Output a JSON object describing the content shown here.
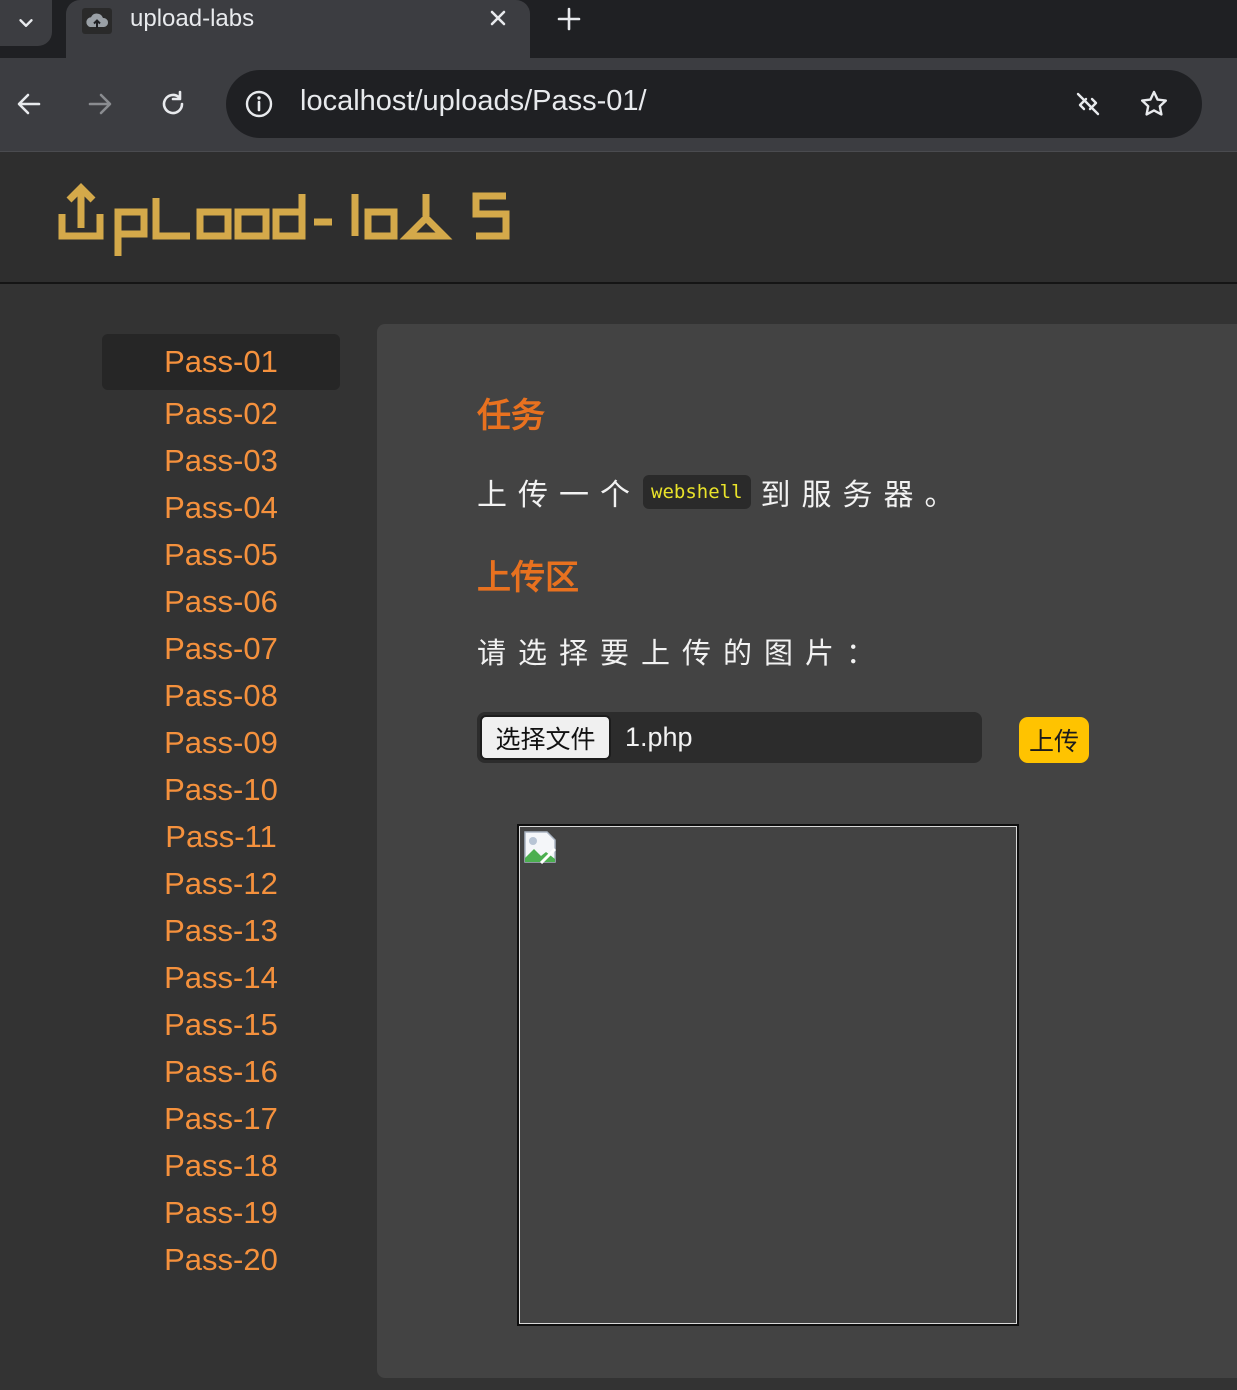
{
  "browser": {
    "tab": {
      "title": "upload-labs"
    },
    "address_bar": {
      "url": "localhost/uploads/Pass-01/"
    }
  },
  "site": {
    "logo_text": "upload-labs"
  },
  "sidebar": {
    "active_index": 0,
    "items": [
      "Pass-01",
      "Pass-02",
      "Pass-03",
      "Pass-04",
      "Pass-05",
      "Pass-06",
      "Pass-07",
      "Pass-08",
      "Pass-09",
      "Pass-10",
      "Pass-11",
      "Pass-12",
      "Pass-13",
      "Pass-14",
      "Pass-15",
      "Pass-16",
      "Pass-17",
      "Pass-18",
      "Pass-19",
      "Pass-20"
    ]
  },
  "task": {
    "title": "任务",
    "text_before": "上传一个",
    "code": "webshell",
    "text_after": "到服务器。"
  },
  "upload": {
    "title": "上传区",
    "label": "请选择要上传的图片：",
    "choose_file_label": "选择文件",
    "file_name": "1.php",
    "submit_label": "上传"
  },
  "colors": {
    "accent_orange": "#e8711f",
    "menu_link": "#f5913d",
    "logo_gold": "#d4a94a",
    "button_yellow": "#ffc300",
    "code_yellow": "#e9e32a"
  }
}
